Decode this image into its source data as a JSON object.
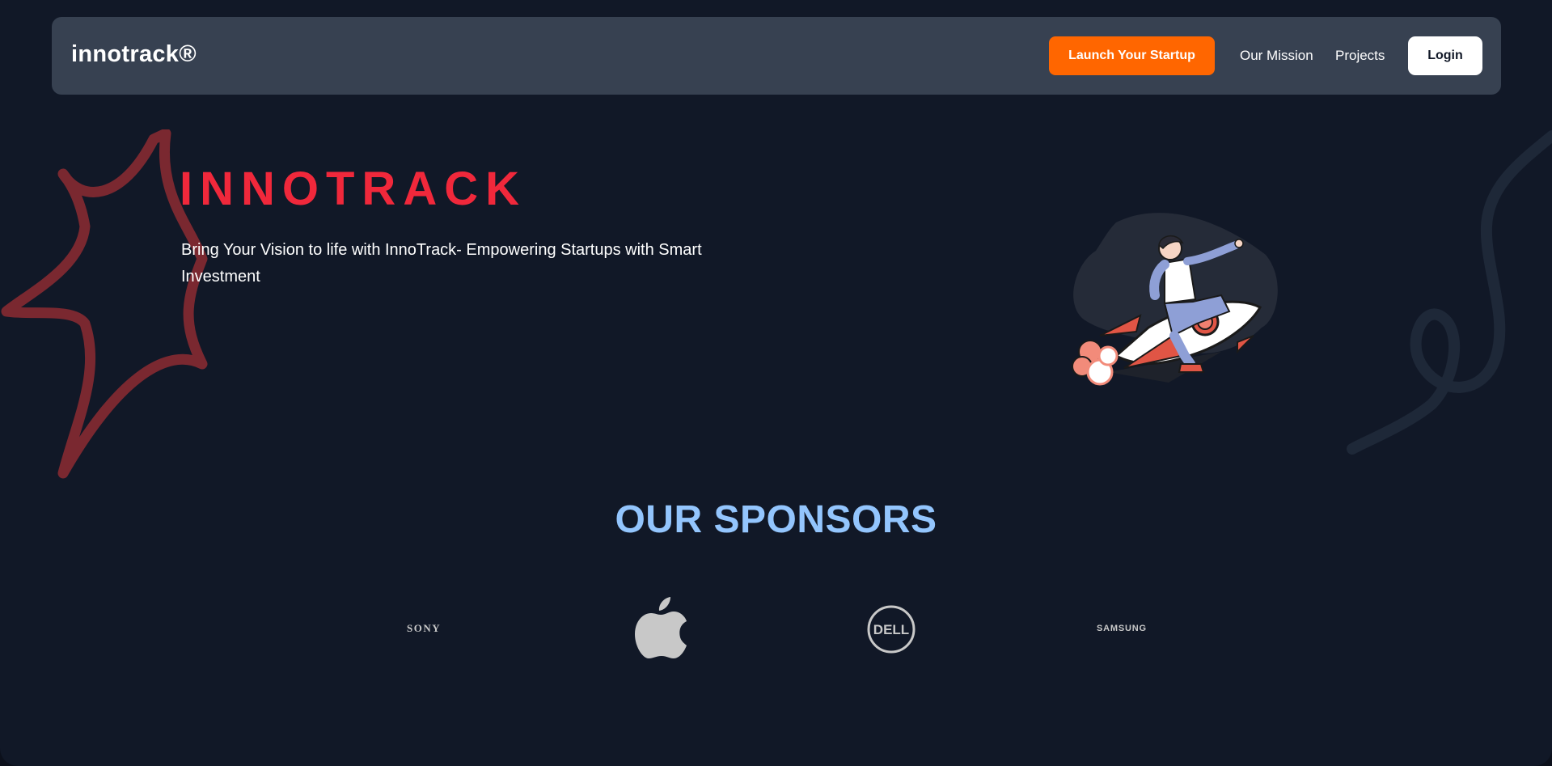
{
  "navbar": {
    "brand": "innotrack®",
    "launch_label": "Launch Your Startup",
    "links": [
      {
        "label": "Our Mission"
      },
      {
        "label": "Projects"
      }
    ],
    "login_label": "Login"
  },
  "hero": {
    "title": "INNOTRACK",
    "subtitle": "Bring Your Vision to life with InnoTrack- Empowering Startups with Smart Investment",
    "illustration_icon": "person-riding-rocket-illustration"
  },
  "sponsors": {
    "title": "OUR SPONSORS",
    "logos": [
      {
        "name": "SONY",
        "icon": "sony-logo"
      },
      {
        "name": "Apple",
        "icon": "apple-logo"
      },
      {
        "name": "DELL",
        "icon": "dell-logo"
      },
      {
        "name": "SAMSUNG",
        "icon": "samsung-logo"
      }
    ]
  },
  "colors": {
    "background": "#111827",
    "navbar": "#374151",
    "accent_orange": "#ff6600",
    "title_red": "#f0283b",
    "sponsors_blue": "#93c5fd"
  }
}
